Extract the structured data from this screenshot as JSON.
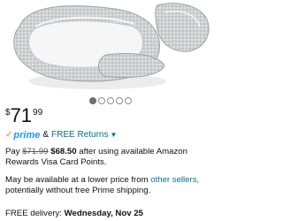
{
  "product": {
    "image_alt": "bassinet-image"
  },
  "carousel": {
    "count": 5,
    "active_index": 0
  },
  "price": {
    "symbol": "$",
    "whole": "71",
    "fraction": "99"
  },
  "prime": {
    "check": "✓",
    "word": "prime",
    "separator": "&",
    "returns_label": "FREE Returns"
  },
  "offer": {
    "pay": "Pay",
    "old_price": "$71.99",
    "new_price": "$68.50",
    "rest": "after using available Amazon Rewards Visa Card Points."
  },
  "availability": {
    "prefix": "May be available at a lower price from",
    "link": "other sellers,",
    "suffix": "potentially without free Prime shipping."
  },
  "delivery": {
    "prefix": "FREE delivery:",
    "date": "Wednesday, Nov 25"
  },
  "colors": {
    "link": "#007185",
    "prime_blue": "#1a98ff",
    "prime_check": "#f3a847"
  }
}
